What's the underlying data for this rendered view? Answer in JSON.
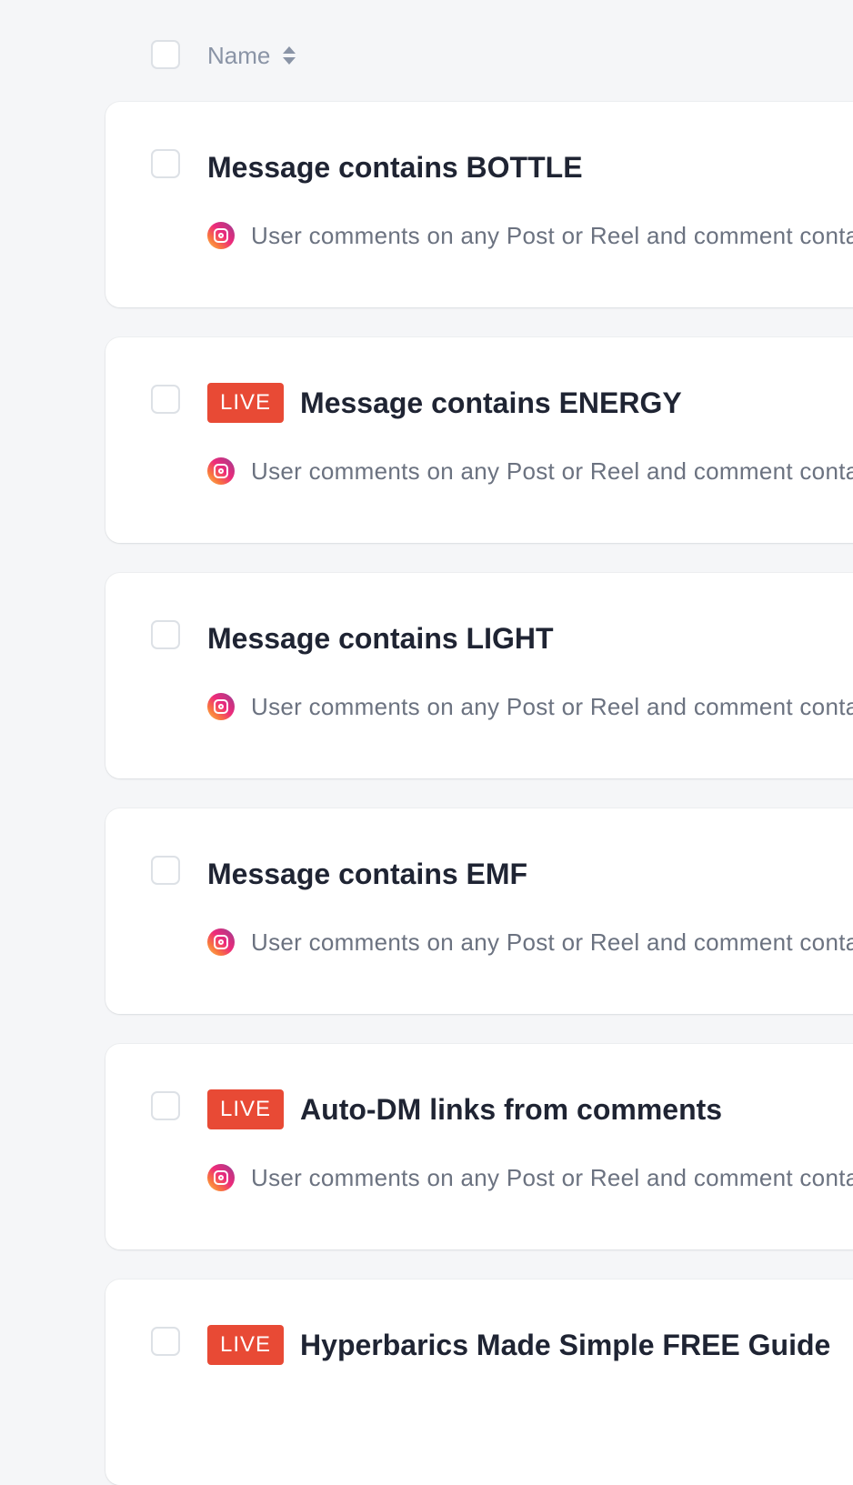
{
  "header": {
    "name_label": "Name"
  },
  "rows": [
    {
      "status": "",
      "title": "Message contains BOTTLE",
      "trigger": "User comments on any Post or Reel and comment contains"
    },
    {
      "status": "LIVE",
      "title": "Message contains ENERGY",
      "trigger": "User comments on any Post or Reel and comment contains"
    },
    {
      "status": "",
      "title": "Message contains LIGHT",
      "trigger": "User comments on any Post or Reel and comment contains"
    },
    {
      "status": "",
      "title": "Message contains EMF",
      "trigger": "User comments on any Post or Reel and comment contains"
    },
    {
      "status": "LIVE",
      "title": "Auto-DM links from comments",
      "trigger": "User comments on any Post or Reel and comment contains"
    },
    {
      "status": "LIVE",
      "title": "Hyperbarics Made Simple FREE Guide",
      "trigger": ""
    }
  ],
  "icons": {
    "sort": "sort-icon",
    "trigger_platform": "instagram-icon"
  },
  "colors": {
    "live_badge": "#e84a35",
    "background": "#f5f6f8",
    "card": "#ffffff"
  }
}
